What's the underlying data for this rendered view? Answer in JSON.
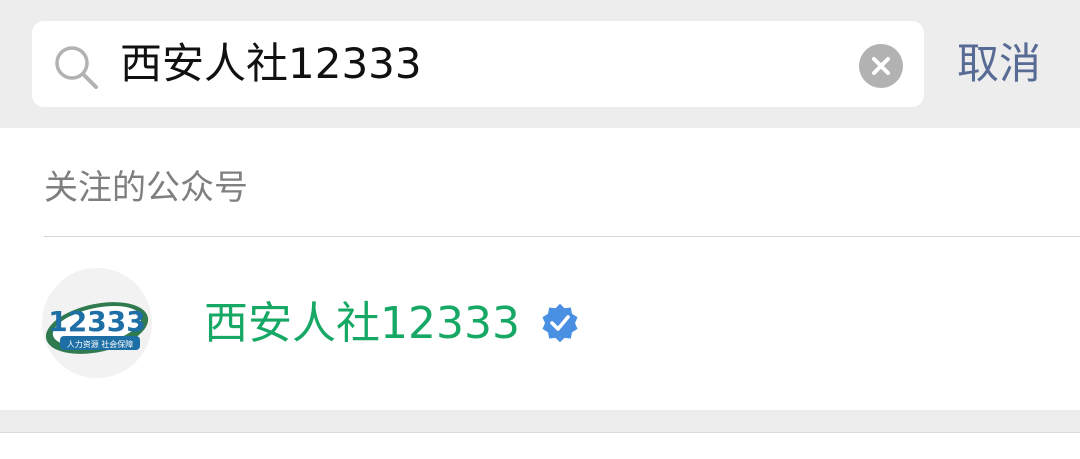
{
  "search": {
    "value": "西安人社12333",
    "cancel_label": "取消"
  },
  "results": {
    "section_title": "关注的公众号",
    "items": [
      {
        "name": "西安人社12333",
        "verified": true,
        "avatar": {
          "logo_number": "12333",
          "logo_caption": "人力资源 社会保障"
        }
      }
    ]
  },
  "colors": {
    "accent_link": "#576b95",
    "match_highlight": "#17a866",
    "verified_badge": "#4a90e2"
  }
}
